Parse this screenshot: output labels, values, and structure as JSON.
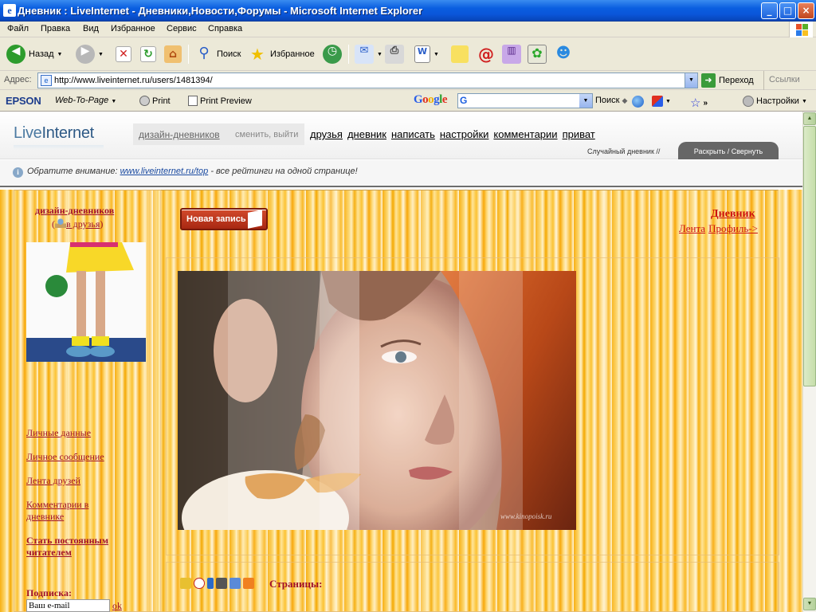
{
  "window": {
    "title": "Дневник : LiveInternet - Дневники,Новости,Форумы - Microsoft Internet Explorer",
    "app_icon": "ie-icon",
    "min": "_",
    "max": "□",
    "close": "×"
  },
  "menu": [
    "Файл",
    "Правка",
    "Вид",
    "Избранное",
    "Сервис",
    "Справка"
  ],
  "toolbar": {
    "back": "Назад",
    "search": "Поиск",
    "favorites": "Избранное"
  },
  "address": {
    "label": "Адрес:",
    "url": "http://www.liveinternet.ru/users/1481394/",
    "go": "Переход",
    "links": "Ссылки"
  },
  "extbar": {
    "epson": "EPSON",
    "web_to_page": "Web-To-Page",
    "print": "Print",
    "print_preview": "Print Preview",
    "google": "Google",
    "google_field": "G",
    "search": "Поиск",
    "settings": "Настройки"
  },
  "site": {
    "logo_a": "Live",
    "logo_b": "Internet",
    "user_name": "дизайн-дневников",
    "user_sub": "сменить, выйти",
    "nav": [
      "друзья",
      "дневник",
      "написать",
      "настройки",
      "комментарии",
      "приват"
    ],
    "random": "Случайный дневник //",
    "expand": "Раскрыть / Свернуть",
    "notice_label": "Обратите внимание:",
    "notice_link": "www.liveinternet.ru/top",
    "notice_text": "- все рейтинги на одной странице!"
  },
  "sidebar": {
    "user": "дизайн-дневников",
    "friends_open": "(",
    "friends": "в друзья",
    "friends_close": ")",
    "links": [
      "Личные данные",
      "Личное сообщение",
      "Лента друзей",
      "Комментарии в",
      "дневнике",
      "Стать постоянным",
      "читателем"
    ],
    "subscribe_label": "Подписка:",
    "email_placeholder": "Ваш e-mail",
    "ok": "ok"
  },
  "main": {
    "new_post": "Новая запись",
    "diary": "Дневник",
    "feed": "Лента",
    "profile": "Профиль->",
    "watermark": "www.kinopoisk.ru",
    "pages": "Страницы:"
  },
  "colors": {
    "accent_red": "#a0102a",
    "title_blue": "#0a55d8",
    "stripe_orange": "#f8b014"
  }
}
